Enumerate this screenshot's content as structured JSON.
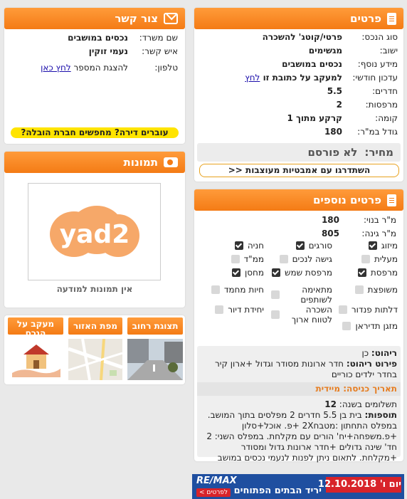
{
  "details": {
    "title": "פרטים",
    "rows": [
      {
        "label": "סוג הנכס:",
        "value": "פרטי/קוטג' להשכרה"
      },
      {
        "label": "ישוב:",
        "value": "מגשימים"
      },
      {
        "label": "מידע נוסף:",
        "value": "נכסים במושבים"
      },
      {
        "label": "עדכון חודשי:",
        "value": "למעקב על כתובת זו",
        "link": "לחץ"
      },
      {
        "label": "חדרים:",
        "value": "5.5"
      },
      {
        "label": "מרפסות:",
        "value": "2"
      },
      {
        "label": "קומה:",
        "value": "קרקע מתוך 1"
      },
      {
        "label": "גודל במ\"ר:",
        "value": "180"
      }
    ],
    "price_label": "מחיר:",
    "price_value": "לא פורסם",
    "ambassador_button": "השתדרגו עם אמבטיות מעוצבות <<"
  },
  "contact": {
    "title": "צור קשר",
    "office_label": "שם משרד:",
    "office_value": "נכסים במושבים",
    "person_label": "איש קשר:",
    "person_value": "נעמי זוקין",
    "phone_label": "טלפון:",
    "phone_text": "להצגת המספר",
    "phone_link": "לחץ כאן",
    "moving_banner": "עוברים דירה? מחפשים חברת הובלה?"
  },
  "photos": {
    "title": "תמונות",
    "logo_text": "yad2",
    "caption": "אין תמונות למודעה"
  },
  "tabs": [
    {
      "label": "תצוגת רחוב"
    },
    {
      "label": "מפת האזור"
    },
    {
      "label": "מעקב על הנכס"
    }
  ],
  "more": {
    "title": "פרטים נוספים",
    "built_label": "מ\"ר בנוי:",
    "built_value": "180",
    "garden_label": "מ\"ר גינה:",
    "garden_value": "805",
    "features": [
      {
        "label": "מיזוג",
        "checked": true
      },
      {
        "label": "סורגים",
        "checked": true
      },
      {
        "label": "חניה",
        "checked": true
      },
      {
        "label": "מעלית",
        "checked": false
      },
      {
        "label": "גישה לנכים",
        "checked": false
      },
      {
        "label": "ממ\"ד",
        "checked": false
      },
      {
        "label": "מרפסת",
        "checked": true
      },
      {
        "label": "מרפסת שמש",
        "checked": true
      },
      {
        "label": "מחסן",
        "checked": true
      },
      {
        "label": "משופצת",
        "checked": false
      },
      {
        "label": "מתאימה לשותפים",
        "checked": false
      },
      {
        "label": "חיות מחמד",
        "checked": false
      },
      {
        "label": "דלתות פנדור",
        "checked": false
      },
      {
        "label": "השכרה לטווח ארוך",
        "checked": false
      },
      {
        "label": "יחידת דיור",
        "checked": false
      },
      {
        "label": "מזגן תדיראן",
        "checked": false
      }
    ],
    "furniture_label": "ריהוט:",
    "furniture_value": "כן",
    "furniture_details_label": "פירוט ריהוט:",
    "furniture_details_value": "חדר ארונות מסודר וגדול +ארון קיר בחדר ילדים כוריים",
    "entry_label": "תאריך כניסה:",
    "entry_value": "מיידית",
    "payments_label": "תשלומים בשנה:",
    "payments_value": "12",
    "additions_label": "תוספות:",
    "additions_value": "בית בן 5.5 חדרים 2 מפלסים בתוך המושב. במפלס התחתון :מטבח2X +פ. אוכל+סלון +פ.משפחה+יח' הורים עם מקלחת. במפלס השני: 2 חד' שינה גדולים +חדר ארונות גדול ומסודר +מקלחת. לתאום ניתן לפנות לנעמי נכסים במושב"
  },
  "ad": {
    "brand": "RE/MAX",
    "date": "12.10.2018",
    "day": "יום ו'",
    "event": "יריד הבתים הפתוחים",
    "cta": "לפרטים >"
  },
  "colors": {
    "accent": "#f47b15",
    "banner_yellow": "#ffe400"
  }
}
